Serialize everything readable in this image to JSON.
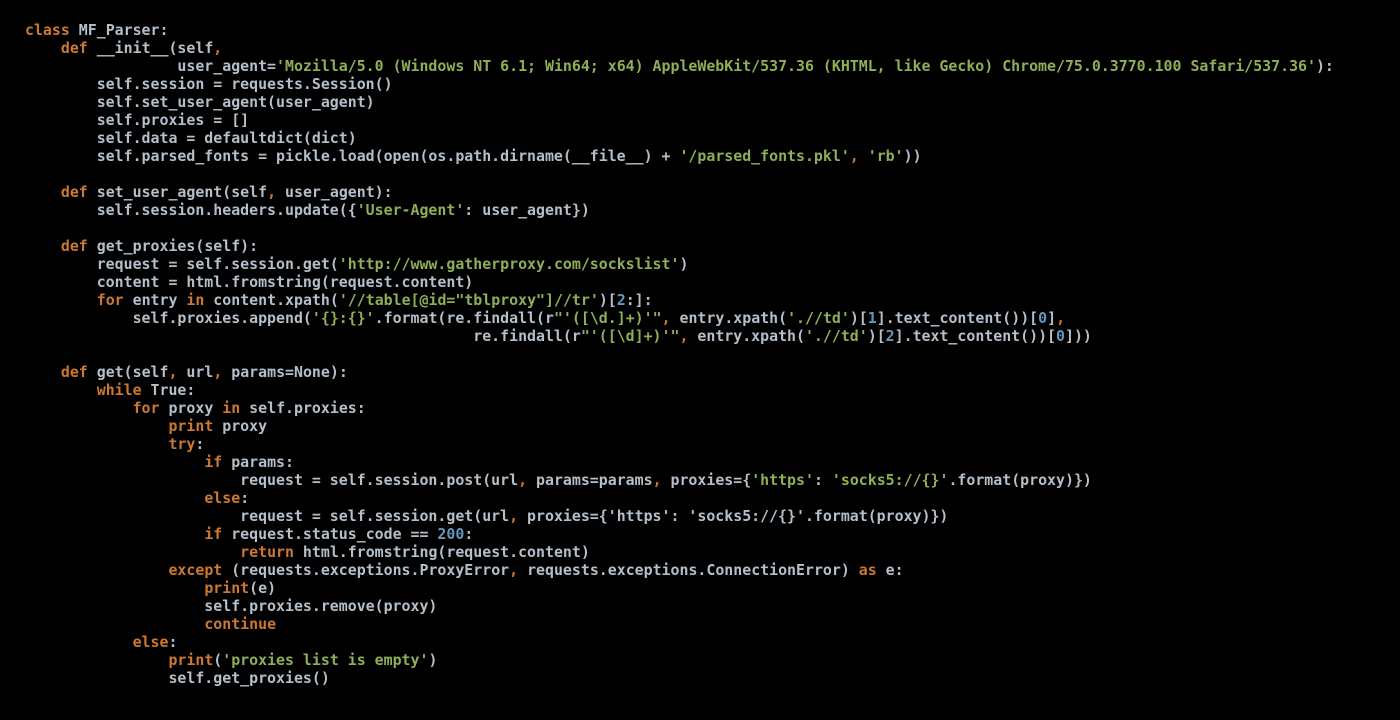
{
  "editor": {
    "language": "python",
    "colors": {
      "background": "#000000",
      "default": "#b4bfc9",
      "keyword": "#cc7832",
      "string": "#8fae57",
      "number": "#6897bb"
    },
    "lines": [
      [
        [
          "kw",
          "class"
        ],
        [
          "txt",
          " MF_Parser:"
        ]
      ],
      [
        [
          "txt",
          "    "
        ],
        [
          "kw",
          "def"
        ],
        [
          "txt",
          " __init__(self"
        ],
        [
          "pun",
          ","
        ]
      ],
      [
        [
          "txt",
          "                 user_agent="
        ],
        [
          "str",
          "'Mozilla/5.0 (Windows NT 6.1; Win64; x64) AppleWebKit/537.36 (KHTML, like Gecko) Chrome/75.0.3770.100 Safari/537.36'"
        ],
        [
          "txt",
          "):"
        ]
      ],
      [
        [
          "txt",
          "        self.session = requests.Session()"
        ]
      ],
      [
        [
          "txt",
          "        self.set_user_agent(user_agent)"
        ]
      ],
      [
        [
          "txt",
          "        self.proxies = []"
        ]
      ],
      [
        [
          "txt",
          "        self.data = defaultdict(dict)"
        ]
      ],
      [
        [
          "txt",
          "        self.parsed_fonts = pickle.load(open(os.path.dirname(__file__) + "
        ],
        [
          "str",
          "'/parsed_fonts.pkl'"
        ],
        [
          "pun",
          ","
        ],
        [
          "txt",
          " "
        ],
        [
          "str",
          "'rb'"
        ],
        [
          "txt",
          "))"
        ]
      ],
      [
        [
          "txt",
          ""
        ]
      ],
      [
        [
          "txt",
          "    "
        ],
        [
          "kw",
          "def"
        ],
        [
          "txt",
          " set_user_agent(self"
        ],
        [
          "pun",
          ","
        ],
        [
          "txt",
          " user_agent):"
        ]
      ],
      [
        [
          "txt",
          "        self.session.headers.update({"
        ],
        [
          "str",
          "'User-Agent'"
        ],
        [
          "txt",
          ": user_agent})"
        ]
      ],
      [
        [
          "txt",
          ""
        ]
      ],
      [
        [
          "txt",
          "    "
        ],
        [
          "kw",
          "def"
        ],
        [
          "txt",
          " get_proxies(self):"
        ]
      ],
      [
        [
          "txt",
          "        request = self.session.get("
        ],
        [
          "str",
          "'http://www.gatherproxy.com/sockslist'"
        ],
        [
          "txt",
          ")"
        ]
      ],
      [
        [
          "txt",
          "        content = html.fromstring(request.content)"
        ]
      ],
      [
        [
          "txt",
          "        "
        ],
        [
          "kw",
          "for"
        ],
        [
          "txt",
          " entry "
        ],
        [
          "kw",
          "in"
        ],
        [
          "txt",
          " content.xpath("
        ],
        [
          "str",
          "'//table[@id=\"tblproxy\"]//tr'"
        ],
        [
          "txt",
          ")["
        ],
        [
          "num",
          "2"
        ],
        [
          "txt",
          ":]:"
        ]
      ],
      [
        [
          "txt",
          "            self.proxies.append("
        ],
        [
          "str",
          "'{}:{}'"
        ],
        [
          "txt",
          ".format(re.findall(r"
        ],
        [
          "str",
          "\"'([\\d.]+)'\""
        ],
        [
          "pun",
          ","
        ],
        [
          "txt",
          " entry.xpath("
        ],
        [
          "str",
          "'.//td'"
        ],
        [
          "txt",
          ")["
        ],
        [
          "num",
          "1"
        ],
        [
          "txt",
          "].text_content())["
        ],
        [
          "num",
          "0"
        ],
        [
          "txt",
          "]"
        ],
        [
          "pun",
          ","
        ]
      ],
      [
        [
          "txt",
          "                                                  re.findall(r"
        ],
        [
          "str",
          "\"'([\\d]+)'\""
        ],
        [
          "pun",
          ","
        ],
        [
          "txt",
          " entry.xpath("
        ],
        [
          "str",
          "'.//td'"
        ],
        [
          "txt",
          ")["
        ],
        [
          "num",
          "2"
        ],
        [
          "txt",
          "].text_content())["
        ],
        [
          "num",
          "0"
        ],
        [
          "txt",
          "]))"
        ]
      ],
      [
        [
          "txt",
          ""
        ]
      ],
      [
        [
          "txt",
          "    "
        ],
        [
          "kw",
          "def"
        ],
        [
          "txt",
          " get(self"
        ],
        [
          "pun",
          ","
        ],
        [
          "txt",
          " url"
        ],
        [
          "pun",
          ","
        ],
        [
          "txt",
          " params=None):"
        ]
      ],
      [
        [
          "txt",
          "        "
        ],
        [
          "kw",
          "while"
        ],
        [
          "txt",
          " True:"
        ]
      ],
      [
        [
          "txt",
          "            "
        ],
        [
          "kw",
          "for"
        ],
        [
          "txt",
          " proxy "
        ],
        [
          "kw",
          "in"
        ],
        [
          "txt",
          " self.proxies:"
        ]
      ],
      [
        [
          "txt",
          "                "
        ],
        [
          "kw",
          "print"
        ],
        [
          "txt",
          " proxy"
        ]
      ],
      [
        [
          "txt",
          "                "
        ],
        [
          "kw",
          "try"
        ],
        [
          "txt",
          ":"
        ]
      ],
      [
        [
          "txt",
          "                    "
        ],
        [
          "kw",
          "if"
        ],
        [
          "txt",
          " params:"
        ]
      ],
      [
        [
          "txt",
          "                        request = self.session.post(url"
        ],
        [
          "pun",
          ","
        ],
        [
          "txt",
          " params=params"
        ],
        [
          "pun",
          ","
        ],
        [
          "txt",
          " proxies={"
        ],
        [
          "str",
          "'https'"
        ],
        [
          "txt",
          ": "
        ],
        [
          "str",
          "'socks5://{}'"
        ],
        [
          "txt",
          ".format(proxy)})"
        ]
      ],
      [
        [
          "txt",
          "                    "
        ],
        [
          "kw",
          "else"
        ],
        [
          "txt",
          ":"
        ]
      ],
      [
        [
          "txt",
          "                        request = self.session.get(url"
        ],
        [
          "pun",
          ","
        ],
        [
          "txt",
          " proxies={'https': 'socks5://{}'.format(proxy)})"
        ]
      ],
      [
        [
          "txt",
          "                    "
        ],
        [
          "kw",
          "if"
        ],
        [
          "txt",
          " request.status_code == "
        ],
        [
          "num",
          "200"
        ],
        [
          "txt",
          ":"
        ]
      ],
      [
        [
          "txt",
          "                        "
        ],
        [
          "kw",
          "return"
        ],
        [
          "txt",
          " html.fromstring(request.content)"
        ]
      ],
      [
        [
          "txt",
          "                "
        ],
        [
          "kw",
          "except"
        ],
        [
          "txt",
          " (requests.exceptions.ProxyError"
        ],
        [
          "pun",
          ","
        ],
        [
          "txt",
          " requests.exceptions.ConnectionError) "
        ],
        [
          "kw",
          "as"
        ],
        [
          "txt",
          " e:"
        ]
      ],
      [
        [
          "txt",
          "                    "
        ],
        [
          "kw",
          "print"
        ],
        [
          "txt",
          "(e)"
        ]
      ],
      [
        [
          "txt",
          "                    self.proxies.remove(proxy)"
        ]
      ],
      [
        [
          "txt",
          "                    "
        ],
        [
          "kw",
          "continue"
        ]
      ],
      [
        [
          "txt",
          "            "
        ],
        [
          "kw",
          "else"
        ],
        [
          "txt",
          ":"
        ]
      ],
      [
        [
          "txt",
          "                "
        ],
        [
          "kw",
          "print"
        ],
        [
          "txt",
          "("
        ],
        [
          "str",
          "'proxies list is empty'"
        ],
        [
          "txt",
          ")"
        ]
      ],
      [
        [
          "txt",
          "                self.get_proxies()"
        ]
      ]
    ]
  }
}
